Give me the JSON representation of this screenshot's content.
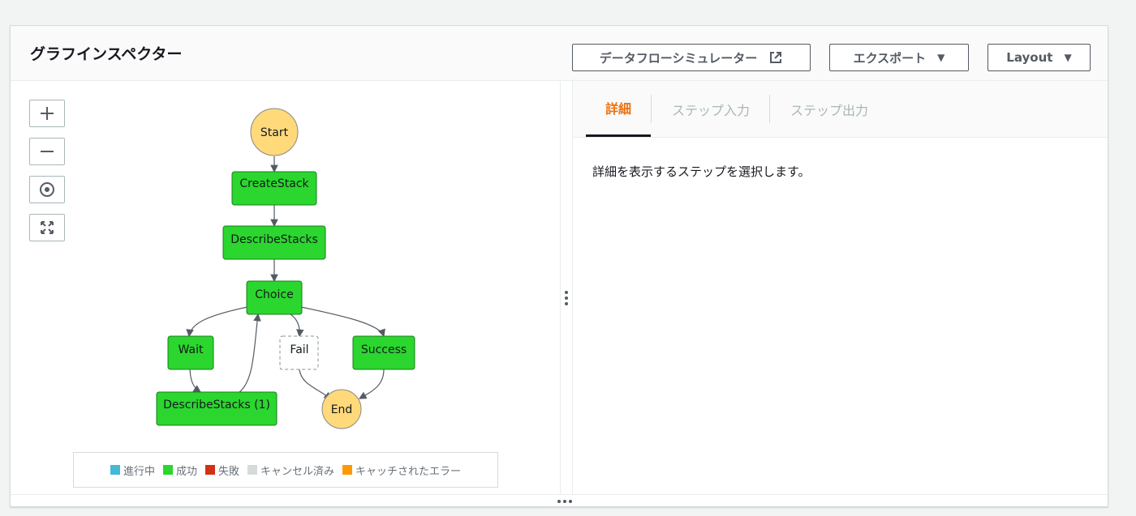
{
  "header": {
    "title": "グラフインスペクター",
    "sim_label": "データフローシミュレーター",
    "export_label": "エクスポート",
    "layout_label": "Layout"
  },
  "graph": {
    "nodes": {
      "start": "Start",
      "create_stack": "CreateStack",
      "describe_stacks": "DescribeStacks",
      "choice": "Choice",
      "wait": "Wait",
      "fail": "Fail",
      "success": "Success",
      "describe_stacks_1": "DescribeStacks (1)",
      "end": "End"
    }
  },
  "legend": [
    {
      "label": "進行中",
      "color": "#44b9d6"
    },
    {
      "label": "成功",
      "color": "#2bd62e"
    },
    {
      "label": "失敗",
      "color": "#d13212"
    },
    {
      "label": "キャンセル済み",
      "color": "#d5dbdb"
    },
    {
      "label": "キャッチされたエラー",
      "color": "#ff9900"
    }
  ],
  "tabs": {
    "details": "詳細",
    "input": "ステップ入力",
    "output": "ステップ出力"
  },
  "details": {
    "empty_message": "詳細を表示するステップを選択します。"
  },
  "colors": {
    "success_fill": "#2bd62e",
    "terminal_fill": "#ffd97a",
    "active_tab": "#ec7211"
  }
}
